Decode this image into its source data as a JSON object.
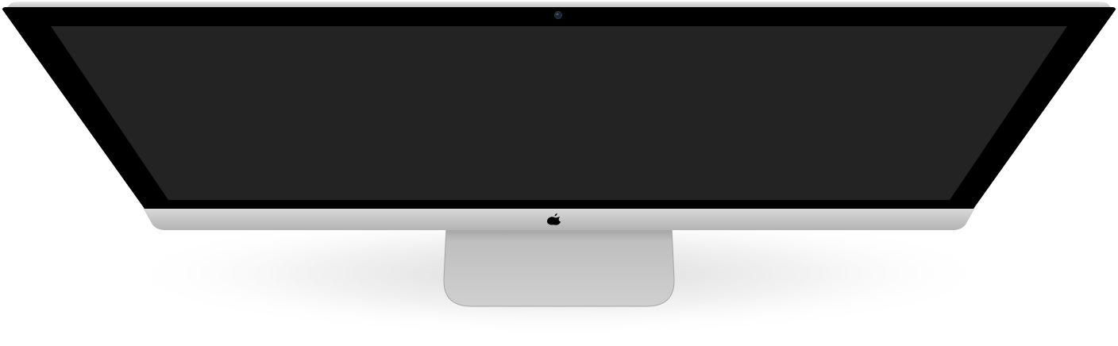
{
  "device": {
    "type": "desktop-monitor-mockup",
    "screen_state": "blank",
    "icon": "apple-logo-icon",
    "colors": {
      "bezel": "#000000",
      "screen": "#232323",
      "chin": "#c9c9c9",
      "stand": "#bdbdbd",
      "shadow": "#d6d6d6",
      "camera": "#1b2330"
    }
  }
}
